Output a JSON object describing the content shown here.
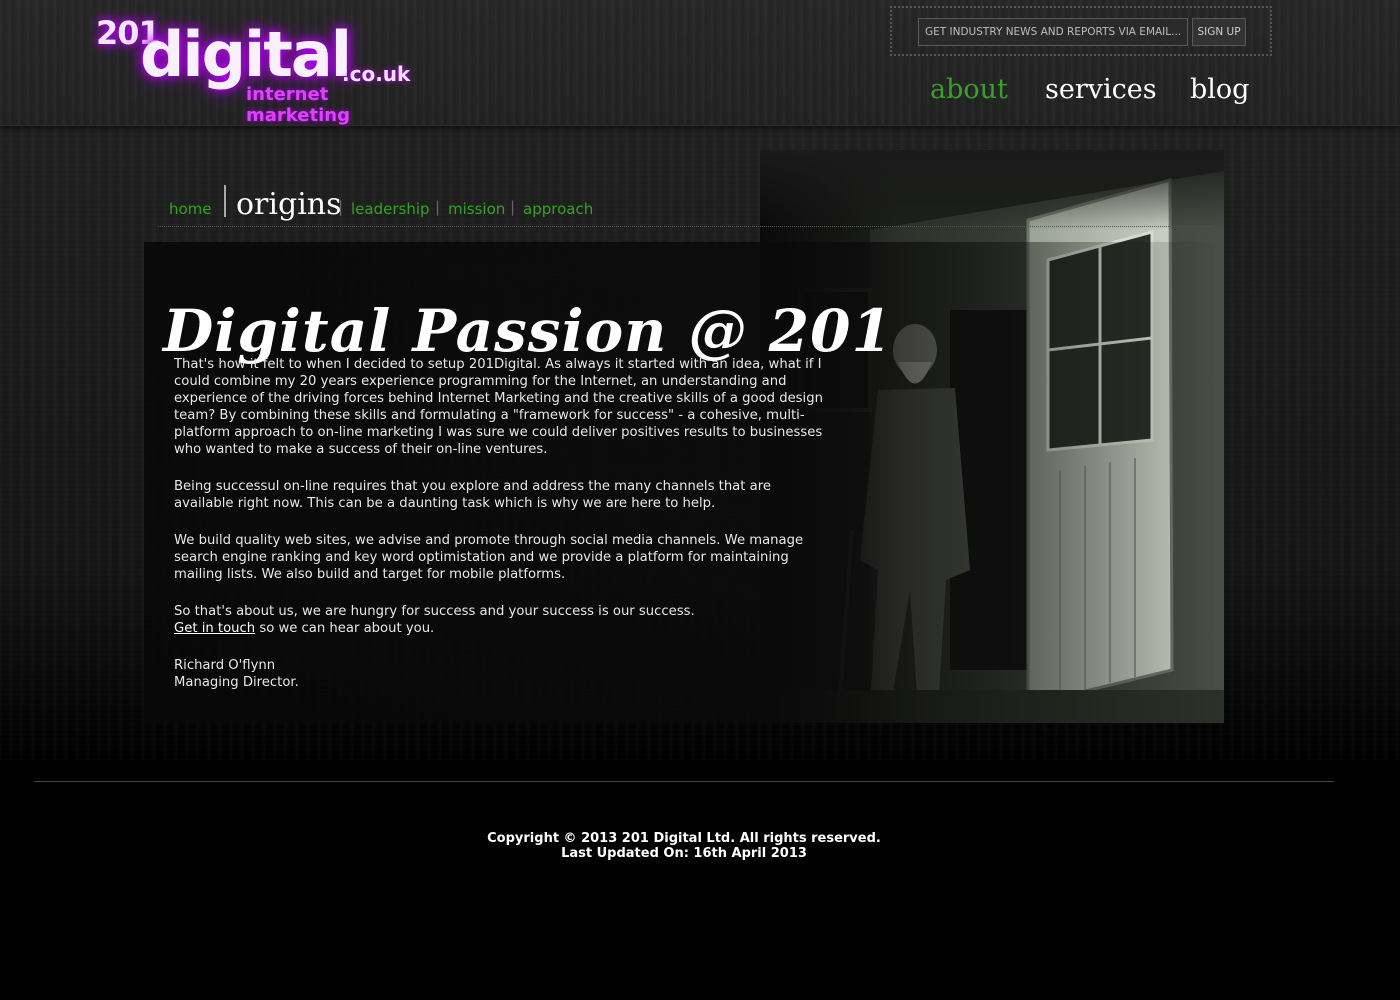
{
  "logo": {
    "number": "201",
    "word": "digital",
    "domain": ".co.uk",
    "tagline": "internet marketing"
  },
  "newsletter": {
    "placeholder": "GET INDUSTRY NEWS AND REPORTS VIA EMAIL...",
    "button_label": "SIGN UP"
  },
  "main_nav": [
    {
      "label": "about",
      "active": true
    },
    {
      "label": "services",
      "active": false
    },
    {
      "label": "blog",
      "active": false
    }
  ],
  "sub_nav": {
    "home": "home",
    "current": "origins",
    "leadership": "leadership",
    "mission": "mission",
    "approach": "approach",
    "separator": "|"
  },
  "content": {
    "headline": "Digital Passion @ 201",
    "paragraph1": "That's how it felt to when I decided to setup 201Digital. As always it started with an idea, what if I could combine my 20 years experience programming for the Internet, an understanding and experience of the driving forces behind Internet Marketing and the creative skills of a good design team? By combining these skills and formulating a \"framework for success\" - a cohesive, multi-platform approach to on-line marketing I was sure we could deliver positives results to businesses who wanted to make a success of their on-line ventures.",
    "paragraph2": "Being successul on-line requires that you explore and address the many channels that are available right now. This can be a daunting task which is why we are here to help.",
    "paragraph3": "We build quality web sites, we advise and promote through social media channels. We manage search engine ranking and key word optimistation and we provide a platform for maintaining mailing lists. We also build and target for mobile platforms.",
    "paragraph4": "So that's about us, we are hungry for success and your success is our success.",
    "get_in_touch_link": "Get in touch",
    "get_in_touch_rest": " so we can hear about you.",
    "signature_name": "Richard O'flynn",
    "signature_title": "Managing Director."
  },
  "footer": {
    "copyright": "Copyright © 2013 201 Digital Ltd. All rights reserved.",
    "updated": "Last Updated On: 16th April 2013"
  },
  "colors": {
    "nav_active": "#3aa02a",
    "subnav_link": "#2fa61f",
    "logo_glow": "#c000ff",
    "tagline": "#e040ff"
  }
}
